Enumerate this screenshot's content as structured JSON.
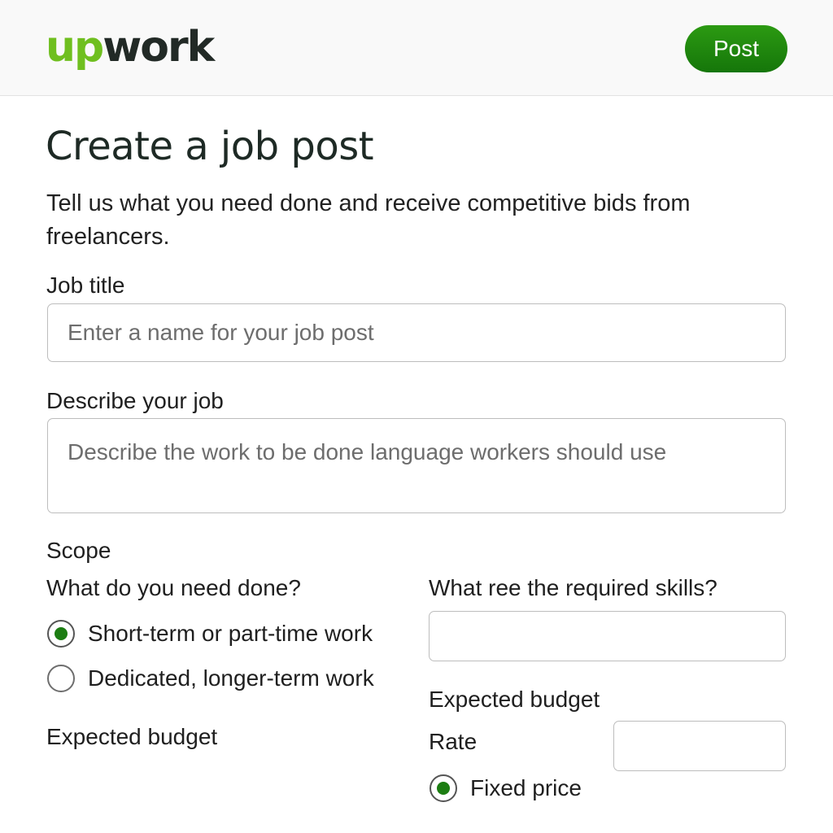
{
  "header": {
    "logo_up": "up",
    "logo_work": "work",
    "post_label": "Post"
  },
  "page": {
    "title": "Create a job post",
    "subtitle": "Tell us what you need done and receive competitive bids from freelancers."
  },
  "job_title": {
    "label": "Job title",
    "placeholder": "Enter a name for your job post"
  },
  "describe": {
    "label": "Describe your job",
    "placeholder": "Describe the work to be done language workers should use"
  },
  "scope": {
    "label": "Scope",
    "question": "What do you need done?",
    "options": [
      {
        "label": "Short-term or part-time work",
        "selected": true
      },
      {
        "label": "Dedicated, longer-term work",
        "selected": false
      }
    ],
    "budget_label": "Expected budget"
  },
  "skills": {
    "label": "What ree the required skills?"
  },
  "budget": {
    "label": "Expected budget",
    "rate_label": "Rate",
    "fixed_price_label": "Fixed price",
    "fixed_price_selected": true
  },
  "colors": {
    "brand_green": "#6fbf1f",
    "button_green": "#1f8a0e",
    "radio_green": "#1c7d12"
  }
}
